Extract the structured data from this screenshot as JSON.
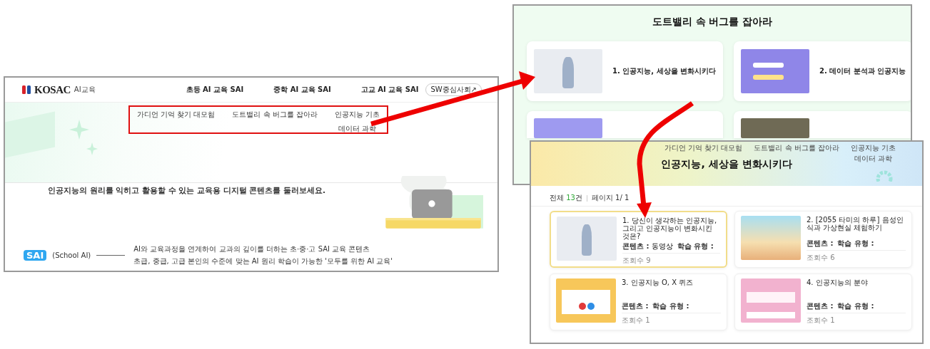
{
  "site_page": {
    "logo": {
      "brand": "KOSAC",
      "suffix": "AI교육"
    },
    "nav": [
      "초등 AI 교육 SAI",
      "중학 AI 교육 SAI",
      "고교 AI 교육 SAI"
    ],
    "external_link": "SW중심사회↗",
    "dropdown_columns": [
      [
        "가디언 기억 찾기 대모험"
      ],
      [
        "도트밸리 속 버그를 잡아라"
      ],
      [
        "인공지능 기초",
        "데이터 과학"
      ]
    ],
    "hero_text": "인공지능의 원리를 익히고 활용할 수 있는 교육용 디지털 콘텐츠를 둘러보세요.",
    "sai": {
      "logo": "SAI",
      "subtitle": "(School AI)",
      "description": [
        "AI와 교육과정을 연계하여 교과의 깊이를 더하는 초·중·고 SAI 교육 콘텐츠",
        "초급, 중급, 고급 본인의 수준에 맞는 AI 원리 학습이 가능한 '모두를 위한 AI 교육'"
      ]
    }
  },
  "course_page": {
    "title": "도트밸리 속 버그를 잡아라",
    "cards": [
      {
        "kind": "photo",
        "title": "1. 인공지능, 세상을 변화시키다"
      },
      {
        "kind": "purple",
        "title": "2. 데이터 분석과 인공지능"
      },
      {
        "kind": "tablet"
      },
      {
        "kind": "game"
      }
    ]
  },
  "lesson_page": {
    "menu_columns": [
      [
        "가디언 기억 찾기 대모험"
      ],
      [
        "도트밸리 속 버그를 잡아라"
      ],
      [
        "인공지능 기초",
        "데이터 과학"
      ]
    ],
    "title": "인공지능, 세상을 변화시키다",
    "total": {
      "label": "전체",
      "count": "13",
      "unit": "건"
    },
    "page": "페이지 1/ 1",
    "cards": [
      {
        "kind": "photo",
        "title": "1. 당신이 생각하는 인공지능, 그리고 인공지능이 변화시킨 것은?",
        "content_label": "콘텐츠 :",
        "content_value": "동영상",
        "type_label": "학습 유형 :",
        "views": "조회수 9",
        "selected": true
      },
      {
        "kind": "room",
        "title": "2. [2055 타미의 하루] 음성인식과 가상현실 체험하기",
        "content_label": "콘텐츠 :",
        "type_label": "학습 유형 :",
        "views": "조회수 6",
        "selected": false
      },
      {
        "kind": "quiz-yellow",
        "title": "3. 인공지능 O, X 퀴즈",
        "content_label": "콘텐츠 :",
        "type_label": "학습 유형 :",
        "views": "조회수 1",
        "selected": false
      },
      {
        "kind": "quiz-pink",
        "title": "4. 인공지능의 분야",
        "content_label": "콘텐츠 :",
        "type_label": "학습 유형 :",
        "views": "조회수 1",
        "selected": false
      }
    ]
  }
}
